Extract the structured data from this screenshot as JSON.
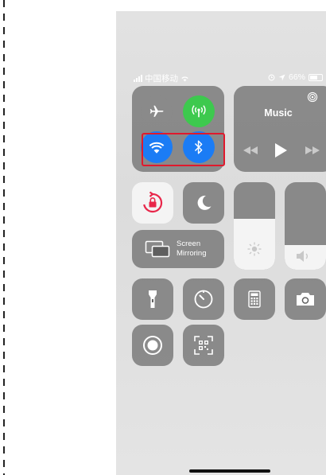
{
  "status_bar": {
    "carrier": "中国移动",
    "battery": "66%"
  },
  "music": {
    "title": "Music"
  },
  "screen_mirroring": {
    "line1": "Screen",
    "line2": "Mirroring"
  },
  "sliders": {
    "brightness_level": 0.58,
    "volume_level": 0.28
  },
  "colors": {
    "cellular_green": "#3dc94e",
    "toggle_blue": "#1b7cf5",
    "highlight_red": "#e0192c",
    "tile_gray": "#5f5f5f"
  },
  "icons": [
    "airplane-icon",
    "cellular-icon",
    "wifi-icon",
    "bluetooth-icon",
    "airplay-icon",
    "previous-icon",
    "play-icon",
    "next-icon",
    "rotation-lock-icon",
    "moon-icon",
    "screen-mirroring-icon",
    "brightness-icon",
    "volume-icon",
    "flashlight-icon",
    "timer-icon",
    "calculator-icon",
    "camera-icon",
    "screen-record-icon",
    "qr-scanner-icon",
    "location-icon",
    "alarm-icon",
    "signal-icon"
  ]
}
